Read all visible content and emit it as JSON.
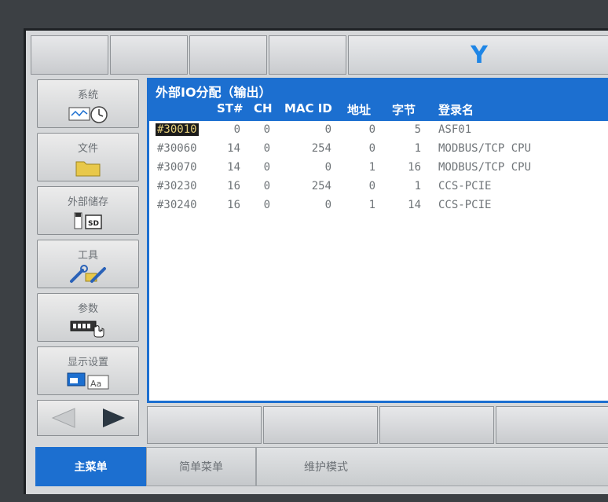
{
  "header": {
    "mode_letter": "Y"
  },
  "menu": [
    {
      "label": "系统",
      "icon": "system-clock-icon"
    },
    {
      "label": "文件",
      "icon": "folder-icon"
    },
    {
      "label": "外部储存",
      "icon": "sd-card-icon"
    },
    {
      "label": "工具",
      "icon": "tools-icon"
    },
    {
      "label": "参数",
      "icon": "parameter-icon"
    },
    {
      "label": "显示设置",
      "icon": "display-settings-icon"
    }
  ],
  "table": {
    "title": "外部IO分配（输出）",
    "columns": [
      "ST#",
      "CH",
      "MAC ID",
      "地址",
      "字节",
      "登录名"
    ],
    "rows": [
      [
        "#30010",
        "0",
        "0",
        "0",
        "0",
        "5",
        "ASF01"
      ],
      [
        "#30060",
        "14",
        "0",
        "254",
        "0",
        "1",
        "MODBUS/TCP CPU"
      ],
      [
        "#30070",
        "14",
        "0",
        "0",
        "1",
        "16",
        "MODBUS/TCP CPU"
      ],
      [
        "#30230",
        "16",
        "0",
        "254",
        "0",
        "1",
        "CCS-PCIE"
      ],
      [
        "#30240",
        "16",
        "0",
        "0",
        "1",
        "14",
        "CCS-PCIE"
      ]
    ]
  },
  "tabs": {
    "main_menu": "主菜单",
    "simple_menu": "简单菜单",
    "maintenance_mode": "维护模式"
  },
  "colors": {
    "accent": "#1c6fd0",
    "mode_letter": "#1f86e6",
    "selected_bg": "#1b1b1b",
    "selected_text": "#e6cf7a"
  }
}
